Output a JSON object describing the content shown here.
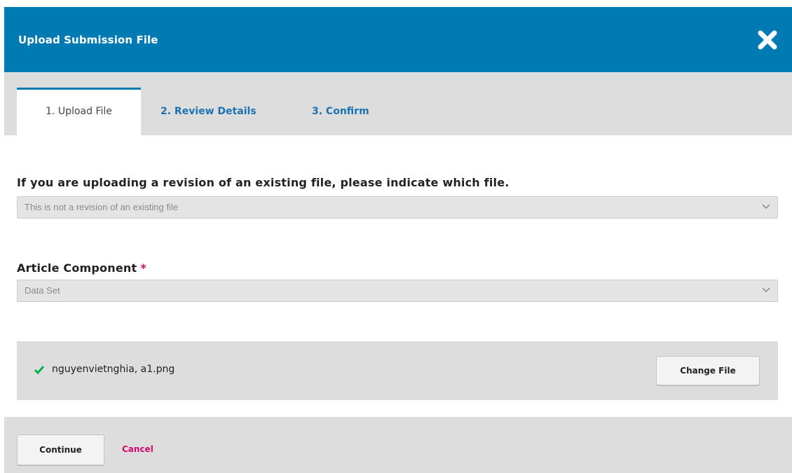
{
  "modal": {
    "title": "Upload Submission File",
    "close_icon": "close-x-icon"
  },
  "tabs": [
    {
      "label": "1. Upload File",
      "active": true
    },
    {
      "label": "2. Review Details",
      "active": false
    },
    {
      "label": "3. Confirm",
      "active": false
    }
  ],
  "form": {
    "revision": {
      "label": "If you are uploading a revision of an existing file, please indicate which file.",
      "selected": "This is not a revision of an existing file"
    },
    "component": {
      "label": "Article Component",
      "required_mark": "*",
      "selected": "Data Set"
    }
  },
  "uploaded_file": {
    "status_icon": "check-icon",
    "name": "nguyenvietnghia, a1.png",
    "change_label": "Change File"
  },
  "footer": {
    "continue_label": "Continue",
    "cancel_label": "Cancel"
  },
  "colors": {
    "header": "#007ab2",
    "tab_link": "#1a73b0",
    "accent_pink": "#d00a6c",
    "success_green": "#00b24e",
    "panel_gray": "#dddddd"
  }
}
